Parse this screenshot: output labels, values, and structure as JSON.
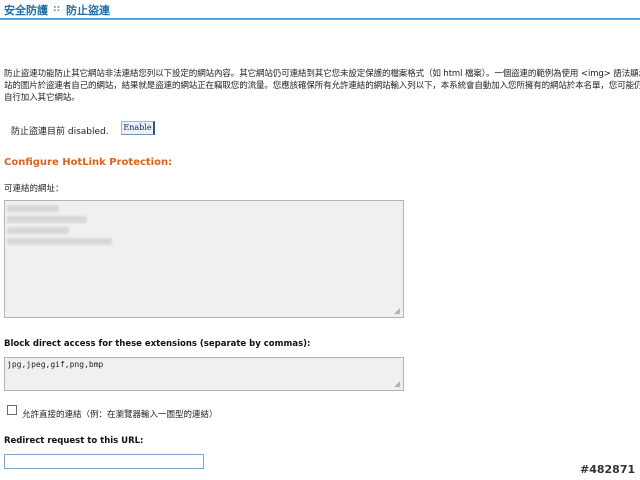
{
  "breadcrumb": {
    "section": "安全防護",
    "separator": "::",
    "page": "防止盜連"
  },
  "description": "防止盜連功能防止其它網站非法連結您列以下設定的網站內容。其它網站仍可連結到其它您未設定保護的檔案格式（如 html 檔案）。一個盜連的範例為使用 <img> 語法顯示您網站的圖片於盜連者自己的網站，結果就是盜連的網站正在竊取您的流量。您應該確保所有允許連結的網站輸入列以下，本系統會自動加入您所擁有的網站於本名單，您可能仍需要自行加入其它網站。",
  "status": {
    "text": "防止盜連目前 disabled.",
    "button_label": "Enable"
  },
  "config": {
    "title": "Configure HotLink Protection:",
    "allowed_label": "可連結的網址：",
    "extensions_label": "Block direct access for these extensions (separate by commas):",
    "extensions_value": "jpg,jpeg,gif,png,bmp",
    "direct_requests_label": "允許直接的連結（例：在瀏覽器輸入一圖型的連結）",
    "direct_requests_checked": false,
    "redirect_label": "Redirect request to this URL:",
    "redirect_value": ""
  },
  "watermark": "#482871",
  "colors": {
    "accent": "#1f6fa8",
    "rule": "#5aa3d6",
    "section_title": "#d9631f"
  }
}
